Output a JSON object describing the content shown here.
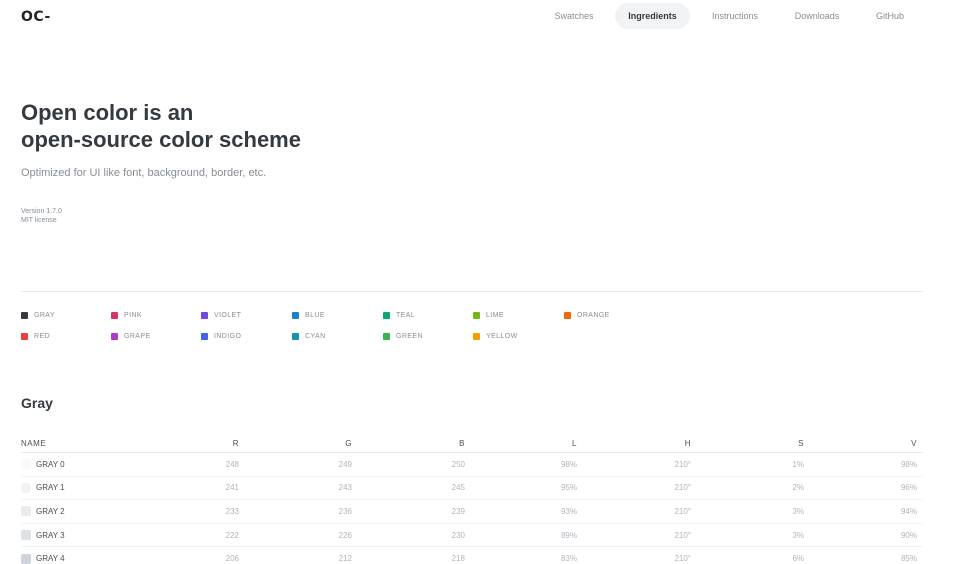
{
  "logo": "OC-",
  "nav": [
    {
      "label": "Swatches",
      "active": false
    },
    {
      "label": "Ingredients",
      "active": true
    },
    {
      "label": "Instructions",
      "active": false
    },
    {
      "label": "Downloads",
      "active": false
    },
    {
      "label": "GitHub",
      "active": false
    }
  ],
  "hero": {
    "title_line1": "Open color is an",
    "title_line2": "open-source color scheme",
    "subtitle": "Optimized for UI like font, background, border, etc.",
    "version": "Version 1.7.0",
    "license": "MIT license"
  },
  "swatches": [
    {
      "label": "GRAY",
      "color": "#343a40"
    },
    {
      "label": "PINK",
      "color": "#d6336c"
    },
    {
      "label": "VIOLET",
      "color": "#7048e8"
    },
    {
      "label": "BLUE",
      "color": "#1c7ed6"
    },
    {
      "label": "TEAL",
      "color": "#0ca678"
    },
    {
      "label": "LIME",
      "color": "#74b816"
    },
    {
      "label": "ORANGE",
      "color": "#f76707"
    },
    {
      "label": "RED",
      "color": "#f03e3e"
    },
    {
      "label": "GRAPE",
      "color": "#ae3ec9"
    },
    {
      "label": "INDIGO",
      "color": "#4263eb"
    },
    {
      "label": "CYAN",
      "color": "#1098ad"
    },
    {
      "label": "GREEN",
      "color": "#37b24d"
    },
    {
      "label": "YELLOW",
      "color": "#f59f00"
    }
  ],
  "section": {
    "title": "Gray",
    "columns": [
      "NAME",
      "R",
      "G",
      "B",
      "L",
      "H",
      "S",
      "V"
    ],
    "rows": [
      {
        "name": "GRAY 0",
        "color": "#f8f9fa",
        "r": "248",
        "g": "249",
        "b": "250",
        "l": "98%",
        "h": "210°",
        "s": "1%",
        "v": "98%"
      },
      {
        "name": "GRAY 1",
        "color": "#f1f3f5",
        "r": "241",
        "g": "243",
        "b": "245",
        "l": "95%",
        "h": "210°",
        "s": "2%",
        "v": "96%"
      },
      {
        "name": "GRAY 2",
        "color": "#e9ecef",
        "r": "233",
        "g": "236",
        "b": "239",
        "l": "93%",
        "h": "210°",
        "s": "3%",
        "v": "94%"
      },
      {
        "name": "GRAY 3",
        "color": "#dee2e6",
        "r": "222",
        "g": "226",
        "b": "230",
        "l": "89%",
        "h": "210°",
        "s": "3%",
        "v": "90%"
      },
      {
        "name": "GRAY 4",
        "color": "#ced4da",
        "r": "206",
        "g": "212",
        "b": "218",
        "l": "83%",
        "h": "210°",
        "s": "6%",
        "v": "85%"
      }
    ]
  }
}
